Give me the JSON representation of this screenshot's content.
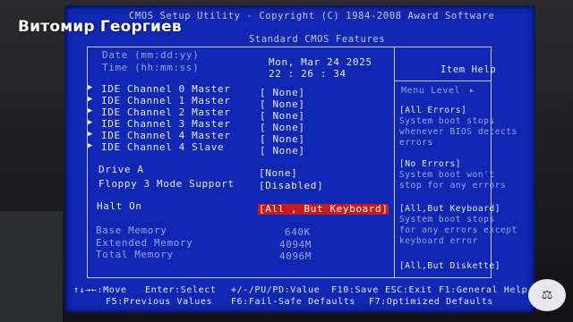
{
  "watermark": "Витомир Георгиев",
  "header": {
    "line1": "CMOS Setup Utility - Copyright (C) 1984-2008 Award Software",
    "line2": "Standard CMOS Features"
  },
  "datetime": {
    "date_label": "Date (mm:dd:yy)",
    "time_label": "Time (hh:mm:ss)",
    "date_value": "Mon, Mar 24 2025",
    "time_value": "22 : 26 : 34"
  },
  "ide": [
    {
      "label": "IDE Channel 0 Master",
      "value": "[ None]"
    },
    {
      "label": "IDE Channel 1 Master",
      "value": "[ None]"
    },
    {
      "label": "IDE Channel 2 Master",
      "value": "[ None]"
    },
    {
      "label": "IDE Channel 3 Master",
      "value": "[ None]"
    },
    {
      "label": "IDE Channel 4 Master",
      "value": "[ None]"
    },
    {
      "label": "IDE Channel 4 Slave",
      "value": "[ None]"
    }
  ],
  "drive": {
    "drive_a_label": "Drive A",
    "drive_a_value": "[None]",
    "floppy_label": "Floppy 3 Mode Support",
    "floppy_value": "[Disabled]"
  },
  "halt": {
    "label": "Halt On",
    "value": "[All , But Keyboard]"
  },
  "memory": {
    "base_label": "Base Memory",
    "base_value": "640K",
    "ext_label": "Extended Memory",
    "ext_value": "4094M",
    "total_label": "Total Memory",
    "total_value": "4096M"
  },
  "help": {
    "title": "Item Help",
    "menu_level": "Menu Level",
    "menu_arrow": "▸",
    "lines": [
      "[All Errors]",
      "System boot stops",
      "whenever BIOS detects",
      "errors",
      "",
      "[No Errors]",
      "System boot won't",
      "stop for any errors",
      "",
      "[All,But Keyboard]",
      "System boot stops",
      "for any errors except",
      "keyboard error",
      "",
      "[All,But Diskette]"
    ]
  },
  "footer": {
    "row1": [
      "↑↓→←:Move",
      "Enter:Select",
      "+/-/PU/PD:Value",
      "F10:Save",
      "ESC:Exit",
      "F1:General Help"
    ],
    "row2": [
      "F5:Previous Values",
      "F6:Fail-Safe Defaults",
      "F7:Optimized Defaults"
    ]
  },
  "badge": "⚖",
  "colors": {
    "bios_blue": "#0f27b3",
    "highlight": "#c81a1a",
    "field_text": "#e8e8ee",
    "help_text": "#9aa4d8"
  }
}
